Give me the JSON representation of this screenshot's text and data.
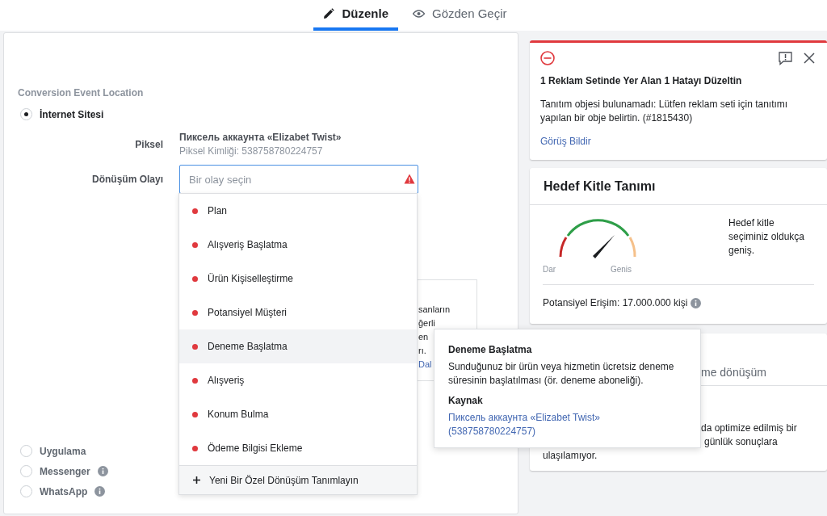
{
  "tabs": [
    {
      "label": "Düzenle",
      "selected": true
    },
    {
      "label": "Gözden Geçir",
      "selected": false
    }
  ],
  "conversion": {
    "heading": "Conversion Event Location",
    "locations": [
      {
        "label": "İnternet Sitesi",
        "checked": true,
        "info": false
      },
      {
        "label": "Uygulama",
        "checked": false,
        "info": false
      },
      {
        "label": "Messenger",
        "checked": false,
        "info": true
      },
      {
        "label": "WhatsApp",
        "checked": false,
        "info": true
      }
    ],
    "pixel_label": "Piksel",
    "pixel_name": "Пиксель аккаунта «Elizabet Twist»",
    "pixel_id": "Piksel Kimliği: 538758780224757",
    "event_label": "Dönüşüm Olayı",
    "event_field": {
      "placeholder": "Bir olay seçin",
      "error": true
    },
    "hidden_box": {
      "lines": [
        "sanların",
        "ğerli",
        "en",
        "rı."
      ],
      "link": "Dal"
    }
  },
  "dropdown": {
    "items": [
      {
        "label": "Plan",
        "highlighted": false
      },
      {
        "label": "Alışveriş Başlatma",
        "highlighted": false
      },
      {
        "label": "Ürün Kişiselleştirme",
        "highlighted": false
      },
      {
        "label": "Potansiyel Müşteri",
        "highlighted": false
      },
      {
        "label": "Deneme Başlatma",
        "highlighted": true
      },
      {
        "label": "Alışveriş",
        "highlighted": false
      },
      {
        "label": "Konum Bulma",
        "highlighted": false
      },
      {
        "label": "Ödeme Bilgisi Ekleme",
        "highlighted": false
      }
    ],
    "footer": "Yeni Bir Özel Dönüşüm Tanımlayın"
  },
  "tooltip": {
    "title": "Deneme Başlatma",
    "description": "Sunduğunuz bir ürün veya hizmetin ücretsiz deneme süresinin başlatılması (ör. deneme aboneliği).",
    "source_label": "Kaynak",
    "source_link": "Пиксель аккаунта «Elizabet Twist» (538758780224757)"
  },
  "error_card": {
    "title": "1 Reklam Setinde Yer Alan 1 Hatayı Düzeltin",
    "message": "Tanıtım objesi bulunamadı: Lütfen reklam seti için tanıtımı yapılan bir obje belirtin. (#1815430)",
    "link": "Görüş Bildir"
  },
  "audience_card": {
    "title": "Hedef Kitle Tanımı",
    "gauge_min": "Dar",
    "gauge_max": "Genis",
    "summary": "Hedef kitle seçiminiz oldukça geniş.",
    "reach": "Potansiyel Erişim: 17.000.000 kişi"
  },
  "third_card": {
    "heading": "me dönüşüm",
    "lines": [
      "da optimize edilmiş bir",
      "günlük sonuçlara",
      "ulaşılamıyor."
    ]
  }
}
